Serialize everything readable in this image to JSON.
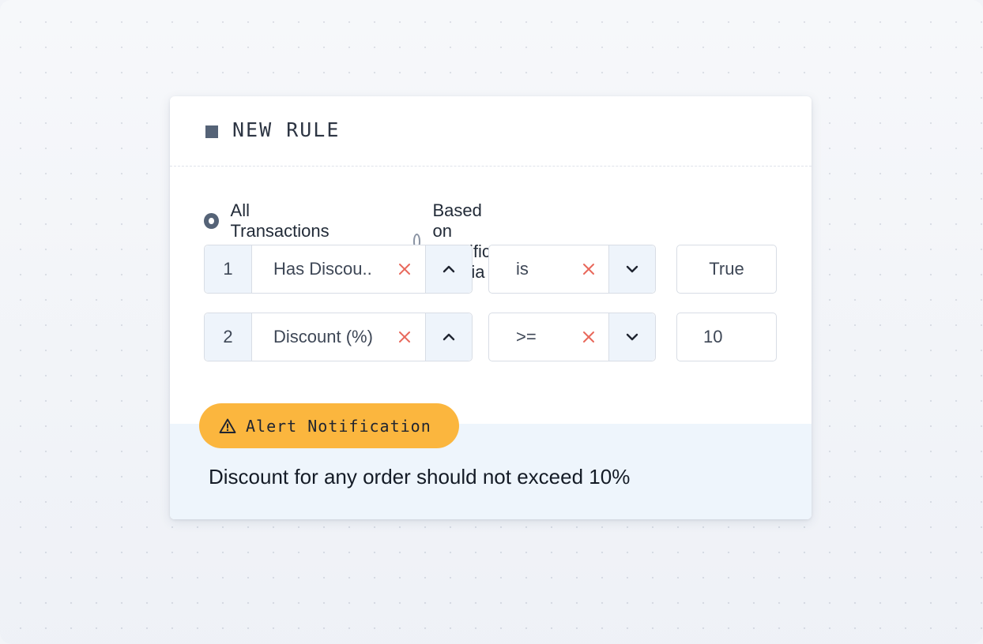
{
  "rule": {
    "title": "NEW RULE",
    "options": [
      {
        "label": "All Transactions",
        "selected": true
      },
      {
        "label": "Based on specific criteria",
        "selected": false
      }
    ],
    "criteria": [
      {
        "index": "1",
        "field": "Has Discou..",
        "operator": "is",
        "value": "True"
      },
      {
        "index": "2",
        "field": "Discount (%)",
        "operator": ">=",
        "value": "10"
      }
    ]
  },
  "alert": {
    "badge_label": "Alert Notification",
    "message": "Discount for any order should not exceed 10%"
  },
  "colors": {
    "accent": "#556377",
    "badge": "#fbb63e",
    "clear_icon": "#e8685b",
    "alert_background": "#eef5fc"
  }
}
